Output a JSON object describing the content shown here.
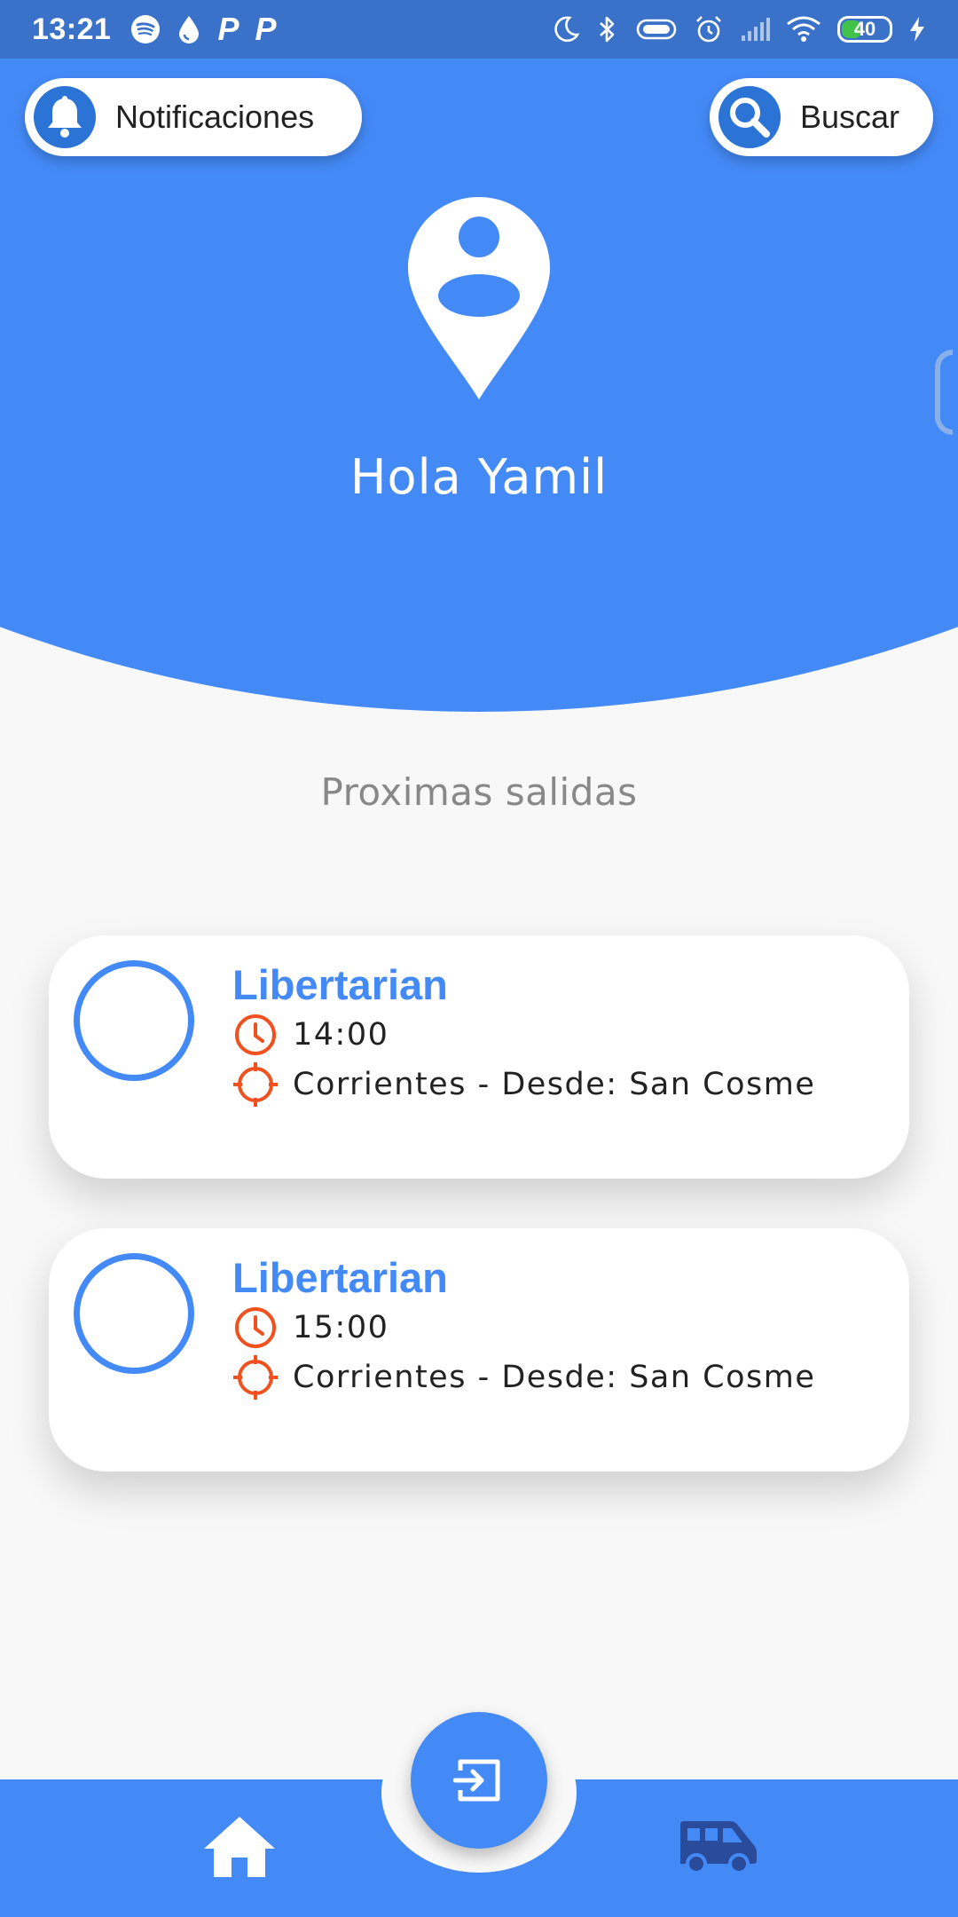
{
  "status_bar": {
    "time": "13:21",
    "battery": "40",
    "app_icons": [
      "spotify-icon",
      "drop-icon",
      "p-icon",
      "p-icon"
    ],
    "p_letter": "P",
    "system_icons": [
      "moon-icon",
      "bluetooth-icon",
      "vibrate-icon",
      "alarm-icon",
      "signal-icon",
      "wifi-icon",
      "battery-icon",
      "charging-icon"
    ]
  },
  "header": {
    "notifications_label": "Notificaciones",
    "search_label": "Buscar",
    "greeting": "Hola Yamil"
  },
  "section_title": "Proximas salidas",
  "departures": [
    {
      "company": "Libertarian",
      "time": "14:00",
      "route": "Corrientes - Desde: San Cosme"
    },
    {
      "company": "Libertarian",
      "time": "15:00",
      "route": "Corrientes - Desde: San Cosme"
    }
  ],
  "bottom_nav": {
    "items": [
      "home-icon",
      "exit-icon",
      "bus-icon"
    ]
  },
  "colors": {
    "primary": "#448af7",
    "status_bar": "#3a72c9",
    "icon_blue": "#2b74d6",
    "accent_orange": "#f0511e",
    "background": "#f8f8f8",
    "muted_text": "#888888",
    "bus_icon": "#2a4a9a"
  }
}
